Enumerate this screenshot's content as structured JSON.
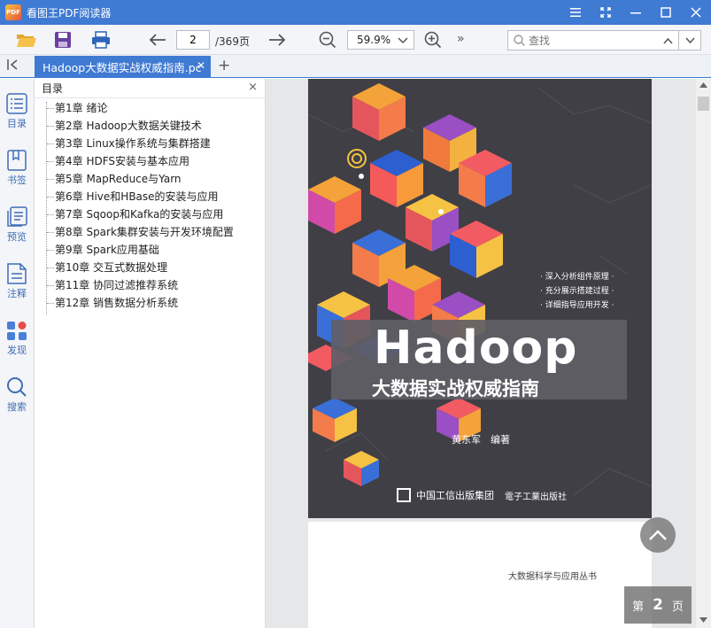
{
  "app": {
    "logo_text": "PDF",
    "title": "看图王PDF阅读器"
  },
  "toolbar": {
    "current_page": "2",
    "total_pages": "/369页",
    "zoom": "59.9%",
    "more": "»",
    "search_placeholder": "查找"
  },
  "tabs": [
    {
      "label": "Hadoop大数据实战权威指南.pc",
      "close": "✕"
    }
  ],
  "sidebar": {
    "items": [
      {
        "label": "目录",
        "icon": "outline-icon"
      },
      {
        "label": "书签",
        "icon": "bookmark-icon"
      },
      {
        "label": "预览",
        "icon": "thumbnail-icon"
      },
      {
        "label": "注释",
        "icon": "annotation-icon"
      },
      {
        "label": "发现",
        "icon": "discover-icon"
      },
      {
        "label": "搜索",
        "icon": "search-icon"
      }
    ]
  },
  "outline": {
    "title": "目录",
    "close": "×",
    "items": [
      "第1章 绪论",
      "第2章 Hadoop大数据关键技术",
      "第3章 Linux操作系统与集群搭建",
      "第4章 HDFS安装与基本应用",
      "第5章 MapReduce与Yarn",
      "第6章 Hive和HBase的安装与应用",
      "第7章 Sqoop和Kafka的安装与应用",
      "第8章 Spark集群安装与开发环境配置",
      "第9章 Spark应用基础",
      "第10章 交互式数据处理",
      "第11章 协同过滤推荐系统",
      "第12章 销售数据分析系统"
    ]
  },
  "cover": {
    "bullets": [
      "· 深入分析组件原理 ·",
      "· 充分展示搭建过程 ·",
      "· 详细指导应用开发 ·"
    ],
    "title_en": "Hadoop",
    "title_cn": "大数据实战权威指南",
    "author": "黄东军　编著",
    "publisher1": "中国工信出版集团",
    "publisher2": "電子工業出版社"
  },
  "page2": {
    "series": "大数据科学与应用丛书"
  },
  "page_indicator": {
    "prefix": "第",
    "num": "2",
    "suffix": "页"
  },
  "colors": {
    "accent": "#3f7ad3",
    "cover_bg": "#403f46"
  }
}
